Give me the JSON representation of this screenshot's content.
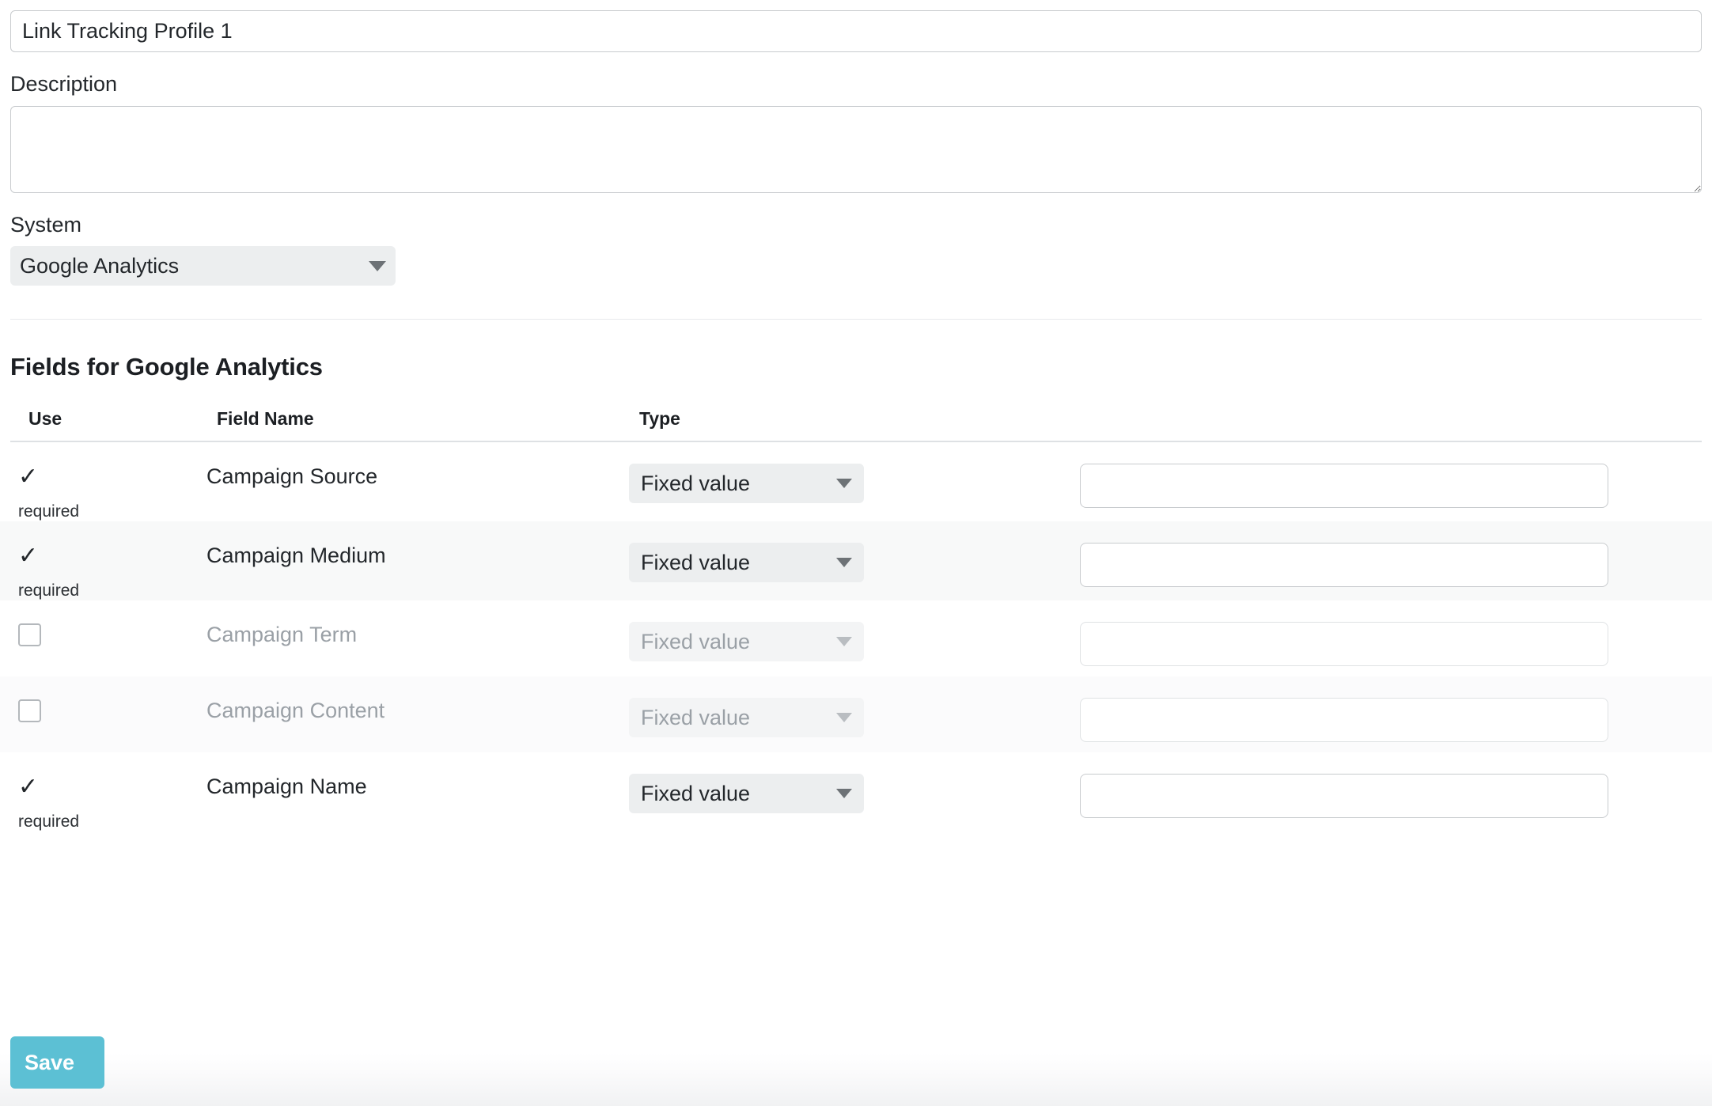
{
  "form": {
    "profile_name_value": "Link Tracking Profile 1",
    "profile_name_placeholder": "",
    "description_label": "Description",
    "description_value": "",
    "description_placeholder": "",
    "system_label": "System",
    "system_value": "Google Analytics",
    "system_options": [
      "Google Analytics"
    ]
  },
  "fields_section": {
    "title": "Fields for Google Analytics",
    "columns": {
      "use": "Use",
      "field_name": "Field Name",
      "type": "Type",
      "value": ""
    },
    "required_note": "required",
    "check_glyph": "✓",
    "rows": [
      {
        "use_checked": true,
        "required": true,
        "name": "Campaign Source",
        "type": "Fixed value",
        "value": "",
        "enabled": true,
        "stripe": false
      },
      {
        "use_checked": true,
        "required": true,
        "name": "Campaign Medium",
        "type": "Fixed value",
        "value": "",
        "enabled": true,
        "stripe": true
      },
      {
        "use_checked": false,
        "required": false,
        "name": "Campaign Term",
        "type": "Fixed value",
        "value": "",
        "enabled": false,
        "stripe": false
      },
      {
        "use_checked": false,
        "required": false,
        "name": "Campaign Content",
        "type": "Fixed value",
        "value": "",
        "enabled": false,
        "stripe": true
      },
      {
        "use_checked": true,
        "required": true,
        "name": "Campaign Name",
        "type": "Fixed value",
        "value": "",
        "enabled": true,
        "stripe": false
      }
    ]
  },
  "footer": {
    "save_label": "Save"
  },
  "colors": {
    "accent": "#5cc0d4",
    "select_bg": "#eceeef",
    "border": "#c8cbce",
    "muted_text": "#9aa0a6",
    "stripe_a": "#f8f9f9",
    "stripe_b": "#fbfbfc"
  }
}
